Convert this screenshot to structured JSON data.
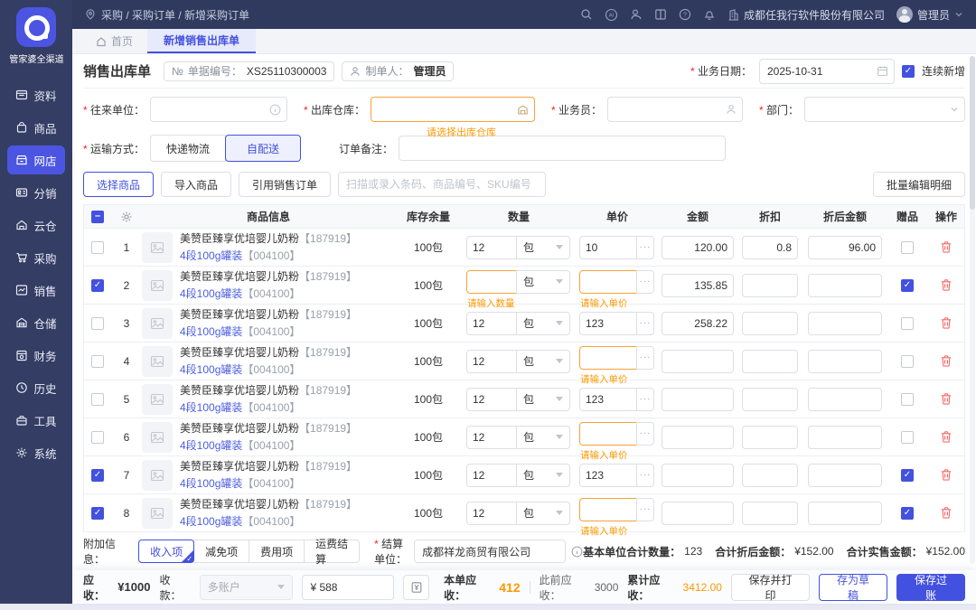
{
  "colors": {
    "primary": "#4351e0",
    "sidebar_bg": "#343d63",
    "topbar_bg": "#303a5e",
    "warning_orange": "#ff9800",
    "danger_red": "#f56c6c",
    "link_blue": "#4c5ee0"
  },
  "sidebar": {
    "logo_text": "管家婆全渠道",
    "items": [
      {
        "label": "资料",
        "icon": "archive"
      },
      {
        "label": "商品",
        "icon": "goods"
      },
      {
        "label": "网店",
        "icon": "store",
        "active": true
      },
      {
        "label": "分销",
        "icon": "distribution"
      },
      {
        "label": "云仓",
        "icon": "cloud-warehouse"
      },
      {
        "label": "采购",
        "icon": "purchase-cart"
      },
      {
        "label": "销售",
        "icon": "sales-chart"
      },
      {
        "label": "仓储",
        "icon": "warehouse"
      },
      {
        "label": "财务",
        "icon": "finance"
      },
      {
        "label": "历史",
        "icon": "history-clock"
      },
      {
        "label": "工具",
        "icon": "tools"
      },
      {
        "label": "系统",
        "icon": "system-gear"
      }
    ]
  },
  "topbar": {
    "breadcrumb": "采购 / 采购订单 / 新增采购订单",
    "icons": [
      "search-icon",
      "ai-icon",
      "contacts-icon",
      "docs-icon",
      "help-icon",
      "bell-icon"
    ],
    "company": "成都任我行软件股份有限公司",
    "user": "管理员"
  },
  "tabs": {
    "home": "首页",
    "active": "新增销售出库单"
  },
  "doc": {
    "title": "销售出库单",
    "no_prefix": "№",
    "no_label": "单据编号：",
    "no": "XS25110300003",
    "creator_label": "制单人：",
    "creator": "管理员",
    "date_label": "业务日期：",
    "date": "2025-10-31",
    "continuous": "连续新增"
  },
  "fields": {
    "partner_label": "往来单位：",
    "warehouse_label": "出库仓库：",
    "warehouse_warning": "请选择出库仓库",
    "salesman_label": "业务员：",
    "department_label": "部门：",
    "transport_label": "运输方式：",
    "transport_options": [
      {
        "label": "快递物流",
        "active": false
      },
      {
        "label": "自配送",
        "active": true
      }
    ],
    "remark_label": "订单备注："
  },
  "toolbar": {
    "select_product": "选择商品",
    "import_product": "导入商品",
    "ref_sales_order": "引用销售订单",
    "scan_placeholder": "扫描或录入条码、商品编号、SKU编号",
    "batch_edit": "批量编辑明细"
  },
  "table": {
    "headers": {
      "product": "商品信息",
      "stock": "库存余量",
      "qty": "数量",
      "price": "单价",
      "amount": "金额",
      "discount": "折扣",
      "discounted": "折后金额",
      "gift": "赠品",
      "action": "操作"
    },
    "rows": [
      {
        "no": "1",
        "checked": false,
        "name": "美赞臣臻享优培婴儿奶粉",
        "code": "【187919】",
        "spec": "4段100g罐装",
        "spec_code": "【004100】",
        "stock": "100包",
        "qty": "12",
        "unit": "包",
        "price": "10",
        "amount": "120.00",
        "discount": "0.8",
        "discounted": "96.00",
        "gift": false
      },
      {
        "no": "2",
        "checked": true,
        "name": "美赞臣臻享优培婴儿奶粉",
        "code": "【187919】",
        "spec": "4段100g罐装",
        "spec_code": "【004100】",
        "stock": "100包",
        "qty": "",
        "qty_warn": "请输入数量",
        "unit": "包",
        "price": "",
        "price_warn": "请输入单价",
        "amount": "135.85",
        "discount": "",
        "discounted": "",
        "gift": true
      },
      {
        "no": "3",
        "checked": false,
        "name": "美赞臣臻享优培婴儿奶粉",
        "code": "【187919】",
        "spec": "4段100g罐装",
        "spec_code": "【004100】",
        "stock": "100包",
        "qty": "12",
        "unit": "包",
        "price": "123",
        "amount": "258.22",
        "discount": "",
        "discounted": "",
        "gift": false
      },
      {
        "no": "4",
        "checked": false,
        "name": "美赞臣臻享优培婴儿奶粉",
        "code": "【187919】",
        "spec": "4段100g罐装",
        "spec_code": "【004100】",
        "stock": "100包",
        "qty": "12",
        "unit": "包",
        "price": "",
        "price_warn": "请输入单价",
        "amount": "",
        "discount": "",
        "discounted": "",
        "gift": false
      },
      {
        "no": "5",
        "checked": false,
        "name": "美赞臣臻享优培婴儿奶粉",
        "code": "【187919】",
        "spec": "4段100g罐装",
        "spec_code": "【004100】",
        "stock": "100包",
        "qty": "12",
        "unit": "包",
        "price": "123",
        "amount": "",
        "discount": "",
        "discounted": "",
        "gift": false
      },
      {
        "no": "6",
        "checked": false,
        "name": "美赞臣臻享优培婴儿奶粉",
        "code": "【187919】",
        "spec": "4段100g罐装",
        "spec_code": "【004100】",
        "stock": "100包",
        "qty": "12",
        "unit": "包",
        "price": "",
        "price_warn": "请输入单价",
        "amount": "",
        "discount": "",
        "discounted": "",
        "gift": false
      },
      {
        "no": "7",
        "checked": true,
        "name": "美赞臣臻享优培婴儿奶粉",
        "code": "【187919】",
        "spec": "4段100g罐装",
        "spec_code": "【004100】",
        "stock": "100包",
        "qty": "12",
        "unit": "包",
        "price": "123",
        "amount": "",
        "discount": "",
        "discounted": "",
        "gift": true
      },
      {
        "no": "8",
        "checked": true,
        "name": "美赞臣臻享优培婴儿奶粉",
        "code": "【187919】",
        "spec": "4段100g罐装",
        "spec_code": "【004100】",
        "stock": "100包",
        "qty": "12",
        "unit": "包",
        "price": "",
        "price_warn": "请输入单价",
        "amount": "",
        "discount": "",
        "discounted": "",
        "gift": true
      }
    ]
  },
  "footer": {
    "extra_label": "附加信息：",
    "extra_options": [
      {
        "label": "收入项",
        "active": true
      },
      {
        "label": "减免项",
        "active": false
      },
      {
        "label": "费用项",
        "active": false
      },
      {
        "label": "运费结算",
        "active": false
      }
    ],
    "settle_label": "结算单位：",
    "settle_value": "成都祥龙商贸有限公司",
    "total_qty_label": "基本单位合计数量：",
    "total_qty": "123",
    "total_discounted_label": "合计折后金额：",
    "total_discounted": "¥152.00",
    "total_actual_label": "合计实售金额：",
    "total_actual": "¥152.00"
  },
  "bottombar": {
    "receivable_label": "应收：",
    "receivable": "¥1000",
    "collect_label": "收款：",
    "account": "多账户",
    "collect_amount": "¥ 588",
    "current_label": "本单应收：",
    "current": "412",
    "previous_label": "此前应收：",
    "previous": "3000",
    "cumulative_label": "累计应收：",
    "cumulative": "3412.00",
    "save_print": "保存并打印",
    "save_draft": "存为草稿",
    "save_post": "保存过账"
  }
}
